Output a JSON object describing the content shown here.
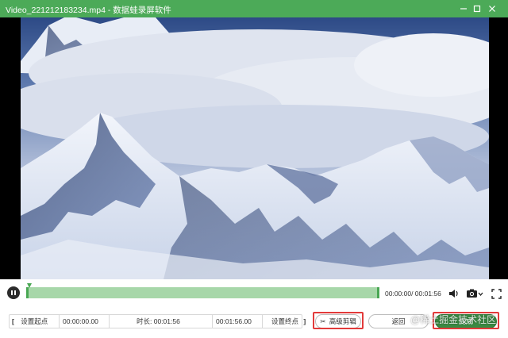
{
  "window": {
    "title": "Video_221212183234.mp4 - 数据蛙录屏软件",
    "accent_color": "#4caa58"
  },
  "player": {
    "time_current": "00:00:00",
    "time_total": "00:01:56",
    "time_display": "00:00:00/ 00:01:56",
    "progress_fraction": 1.0
  },
  "edit": {
    "set_start_label": "设置起点",
    "start_value": "00:00:00.00",
    "duration_label": "时长: 00:01:56",
    "end_value": "00:01:56.00",
    "set_end_label": "设置终点",
    "advanced_label": "高级剪辑",
    "back_label": "返回",
    "complete_label": "完成"
  },
  "watermark": "@稀土掘金技术社区"
}
